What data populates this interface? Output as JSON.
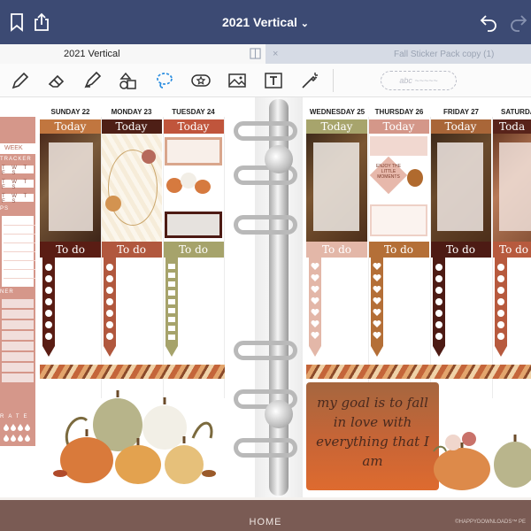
{
  "app": {
    "title": "2021 Vertical",
    "title_chevron": "⌄",
    "tabs": [
      {
        "label": "2021 Vertical",
        "active": true
      },
      {
        "label": "Fall Sticker Pack copy (1)",
        "active": false,
        "close": "×"
      }
    ],
    "pen_preview": "abc ~~~~~",
    "footer_home": "HOME",
    "footer_credit": "©HAPPYDOWNLOADS™ PE"
  },
  "toolbar": {
    "icons": [
      "pen-icon",
      "eraser-icon",
      "highlighter-icon",
      "shapes-icon",
      "lasso-icon",
      "sticker-icon",
      "image-icon",
      "text-icon",
      "laser-pointer-icon"
    ]
  },
  "sidebar": {
    "week_label": "WEEK",
    "tracker_label": "TRACKER",
    "track_rows": [
      "T W T F S",
      "T W T F S",
      "T W T F S"
    ],
    "maps_label": "PS",
    "planner_label": "NER",
    "rate_label": "RATE",
    "drops": "💧💧💧💧💧💧💧💧💧💧💧💧💧💧💧💧💧💧💧💧💧💧💧💧💧💧💧💧💧💧💧💧💧💧💧💧💧💧💧💧"
  },
  "left_days": [
    {
      "name": "SUNDAY 22",
      "today": "Today",
      "todo": "To do",
      "head_color": "#c1763f",
      "todo_color": "#5a1d14",
      "checks": "dots"
    },
    {
      "name": "MONDAY 23",
      "today": "Today",
      "todo": "To do",
      "head_color": "#4e1f16",
      "todo_color": "#b1583e",
      "checks": "dots"
    },
    {
      "name": "TUESDAY 24",
      "today": "Today",
      "todo": "To do",
      "head_color": "#c0553c",
      "todo_color": "#a6a36b",
      "checks": "boxes"
    }
  ],
  "right_days": [
    {
      "name": "WEDNESDAY 25",
      "today": "Today",
      "todo": "To do",
      "head_color": "#a7a46c",
      "todo_color": "#e3b7a8",
      "checks": "hearts"
    },
    {
      "name": "THURSDAY 26",
      "today": "Today",
      "todo": "To do",
      "head_color": "#d49789",
      "todo_color": "#b46f37",
      "checks": "hearts"
    },
    {
      "name": "FRIDAY 27",
      "today": "Today",
      "todo": "To do",
      "head_color": "#a96638",
      "todo_color": "#4d1b14",
      "checks": "dots"
    },
    {
      "name": "SATURDAY",
      "today": "Toda",
      "todo": "To do",
      "head_color": "#58231a",
      "todo_color": "#b75a3e",
      "checks": "dots"
    }
  ],
  "stickers": {
    "thursday_label": "ENJOY THE LITTLE MOMENTS",
    "quote": "my goal is to fall in love with everything that I am"
  }
}
